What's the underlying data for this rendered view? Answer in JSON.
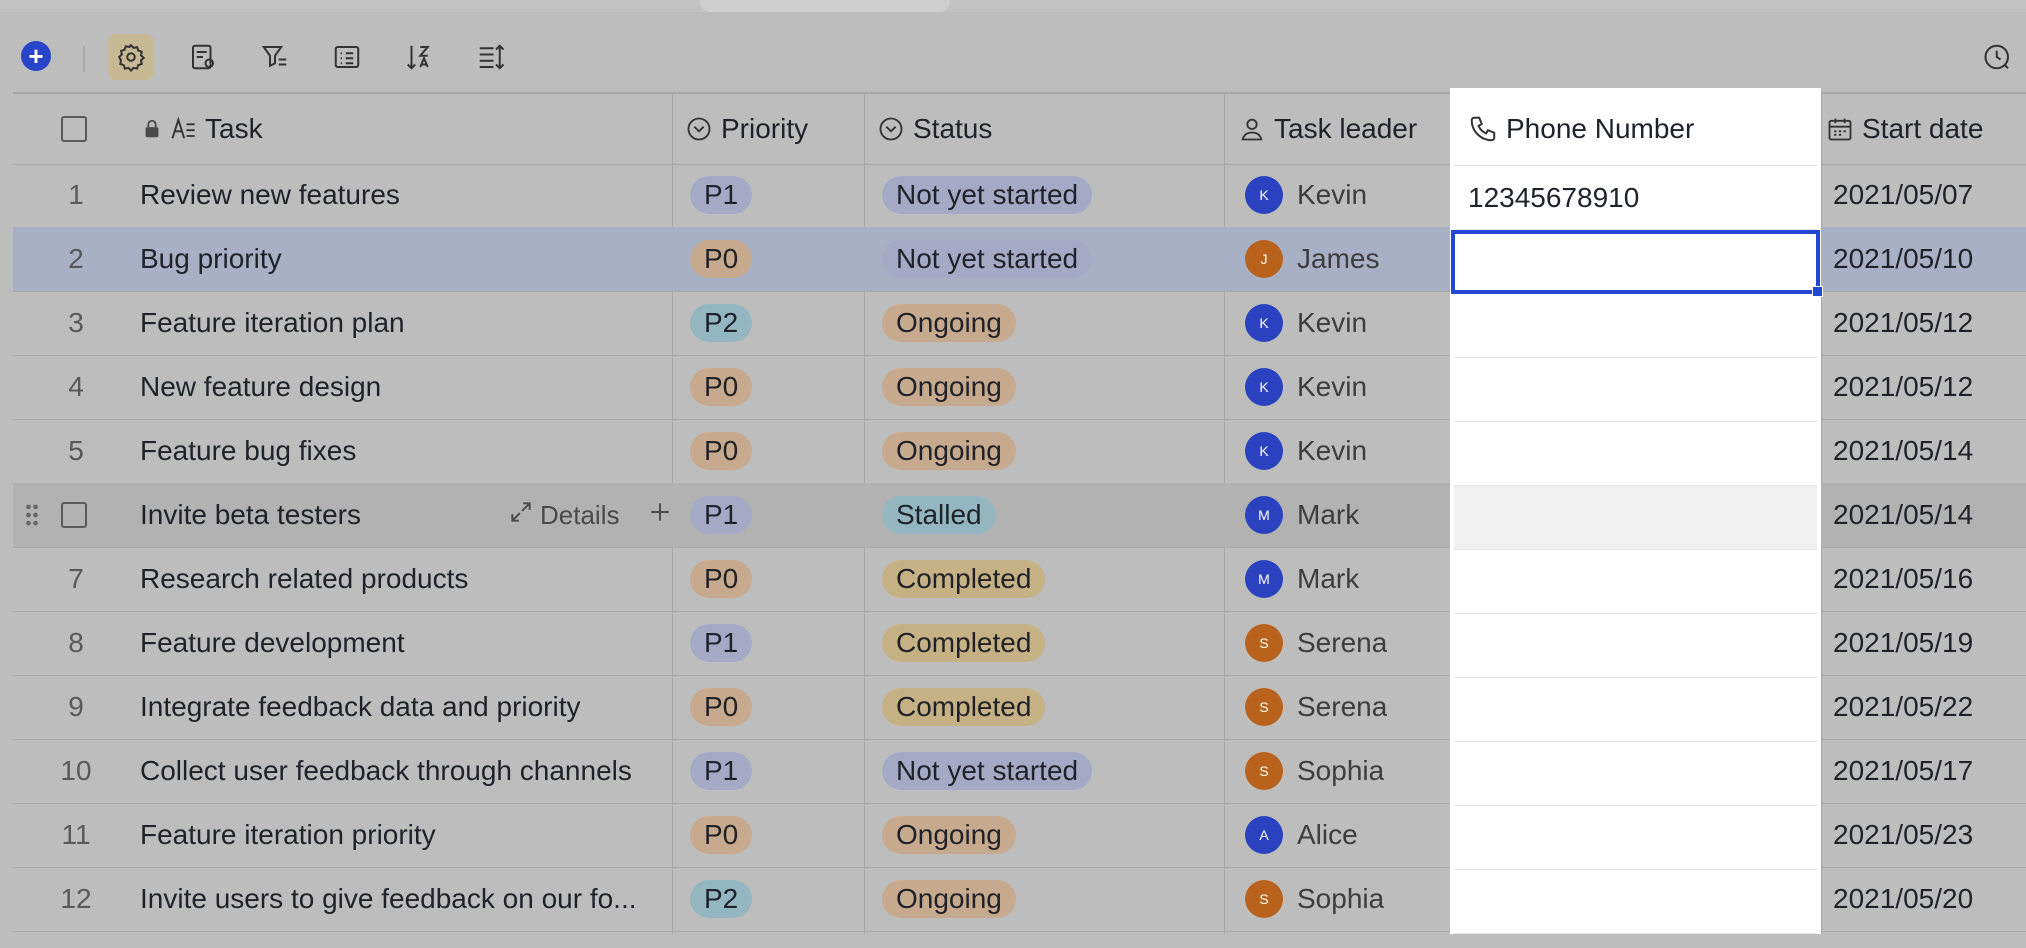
{
  "toolbar": {
    "icons": [
      "add-icon",
      "settings-icon",
      "form-settings-icon",
      "filter-icon",
      "list-icon",
      "sort-icon",
      "row-height-icon",
      "history-icon"
    ]
  },
  "columns": {
    "task": "Task",
    "priority": "Priority",
    "status": "Status",
    "task_leader": "Task leader",
    "phone_number": "Phone Number",
    "start_date": "Start date"
  },
  "row_actions": {
    "details": "Details"
  },
  "rows": [
    {
      "num": "1",
      "task": "Review new features",
      "priority": "P1",
      "status": "Not yet started",
      "leader_initial": "K",
      "leader": "Kevin",
      "phone": "12345678910",
      "date": "2021/05/07"
    },
    {
      "num": "2",
      "task": "Bug priority",
      "priority": "P0",
      "status": "Not yet started",
      "leader_initial": "J",
      "leader": "James",
      "phone": "",
      "date": "2021/05/10"
    },
    {
      "num": "3",
      "task": "Feature iteration plan",
      "priority": "P2",
      "status": "Ongoing",
      "leader_initial": "K",
      "leader": "Kevin",
      "phone": "",
      "date": "2021/05/12"
    },
    {
      "num": "4",
      "task": "New feature design",
      "priority": "P0",
      "status": "Ongoing",
      "leader_initial": "K",
      "leader": "Kevin",
      "phone": "",
      "date": "2021/05/12"
    },
    {
      "num": "5",
      "task": "Feature bug fixes",
      "priority": "P0",
      "status": "Ongoing",
      "leader_initial": "K",
      "leader": "Kevin",
      "phone": "",
      "date": "2021/05/14"
    },
    {
      "num": "",
      "task": "Invite beta testers",
      "priority": "P1",
      "status": "Stalled",
      "leader_initial": "M",
      "leader": "Mark",
      "phone": "",
      "date": "2021/05/14"
    },
    {
      "num": "7",
      "task": "Research related products",
      "priority": "P0",
      "status": "Completed",
      "leader_initial": "M",
      "leader": "Mark",
      "phone": "",
      "date": "2021/05/16"
    },
    {
      "num": "8",
      "task": "Feature development",
      "priority": "P1",
      "status": "Completed",
      "leader_initial": "S",
      "leader": "Serena",
      "phone": "",
      "date": "2021/05/19"
    },
    {
      "num": "9",
      "task": "Integrate feedback data and priority",
      "priority": "P0",
      "status": "Completed",
      "leader_initial": "S",
      "leader": "Serena",
      "phone": "",
      "date": "2021/05/22"
    },
    {
      "num": "10",
      "task": "Collect user feedback through channels",
      "priority": "P1",
      "status": "Not yet started",
      "leader_initial": "S",
      "leader": "Sophia",
      "phone": "",
      "date": "2021/05/17"
    },
    {
      "num": "11",
      "task": "Feature iteration priority",
      "priority": "P0",
      "status": "Ongoing",
      "leader_initial": "A",
      "leader": "Alice",
      "phone": "",
      "date": "2021/05/23"
    },
    {
      "num": "12",
      "task": "Invite users to give feedback on our fo...",
      "priority": "P2",
      "status": "Ongoing",
      "leader_initial": "S",
      "leader": "Sophia",
      "phone": "",
      "date": "2021/05/20"
    }
  ]
}
